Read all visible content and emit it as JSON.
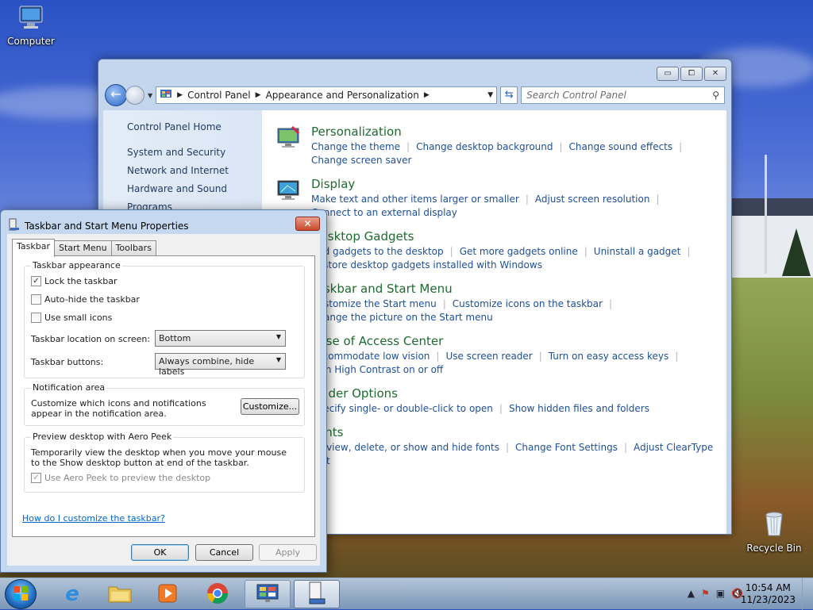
{
  "desktop": {
    "computer_label": "Computer",
    "recycle_bin_label": "Recycle Bin"
  },
  "control_panel": {
    "caption_buttons": {
      "minimize": "▭",
      "maximize": "⧠",
      "close": "✕"
    },
    "address": {
      "crumbs": [
        "Control Panel",
        "Appearance and Personalization"
      ]
    },
    "search_placeholder": "Search Control Panel",
    "left_nav": {
      "home": "Control Panel Home",
      "items": [
        "System and Security",
        "Network and Internet",
        "Hardware and Sound",
        "Programs"
      ]
    },
    "categories": [
      {
        "title": "Personalization",
        "icon": "personalization-icon",
        "links": [
          "Change the theme",
          "Change desktop background",
          "Change sound effects",
          "Change screen saver"
        ]
      },
      {
        "title": "Display",
        "icon": "display-icon",
        "links": [
          "Make text and other items larger or smaller",
          "Adjust screen resolution",
          "Connect to an external display"
        ]
      },
      {
        "title": "Desktop Gadgets",
        "icon": "gadgets-icon",
        "links": [
          "Add gadgets to the desktop",
          "Get more gadgets online",
          "Uninstall a gadget",
          "Restore desktop gadgets installed with Windows"
        ]
      },
      {
        "title": "Taskbar and Start Menu",
        "icon": "taskbar-icon",
        "links": [
          "Customize the Start menu",
          "Customize icons on the taskbar",
          "Change the picture on the Start menu"
        ]
      },
      {
        "title": "Ease of Access Center",
        "icon": "ease-of-access-icon",
        "links": [
          "Accommodate low vision",
          "Use screen reader",
          "Turn on easy access keys",
          "Turn High Contrast on or off"
        ]
      },
      {
        "title": "Folder Options",
        "icon": "folder-options-icon",
        "links": [
          "Specify single- or double-click to open",
          "Show hidden files and folders"
        ]
      },
      {
        "title": "Fonts",
        "icon": "fonts-icon",
        "links": [
          "Preview, delete, or show and hide fonts",
          "Change Font Settings",
          "Adjust ClearType text"
        ]
      }
    ]
  },
  "dialog": {
    "title": "Taskbar and Start Menu Properties",
    "tabs": [
      "Taskbar",
      "Start Menu",
      "Toolbars"
    ],
    "taskbar_appearance": {
      "heading": "Taskbar appearance",
      "lock_label": "Lock the taskbar",
      "lock_checked": true,
      "autohide_label": "Auto-hide the taskbar",
      "autohide_checked": false,
      "small_icons_label": "Use small icons",
      "small_icons_checked": false,
      "location_label": "Taskbar location on screen:",
      "location_value": "Bottom",
      "buttons_label": "Taskbar buttons:",
      "buttons_value": "Always combine, hide labels"
    },
    "notification_area": {
      "heading": "Notification area",
      "description": "Customize which icons and notifications appear in the notification area.",
      "customize_button": "Customize..."
    },
    "aero_peek": {
      "heading": "Preview desktop with Aero Peek",
      "description": "Temporarily view the desktop when you move your mouse to the Show desktop button at end of the taskbar.",
      "checkbox_label": "Use Aero Peek to preview the desktop",
      "checked": true
    },
    "help_link": "How do I customize the taskbar?",
    "buttons": {
      "ok": "OK",
      "cancel": "Cancel",
      "apply": "Apply"
    }
  },
  "taskbar": {
    "clock_time": "10:54 AM",
    "clock_date": "11/23/2023"
  }
}
